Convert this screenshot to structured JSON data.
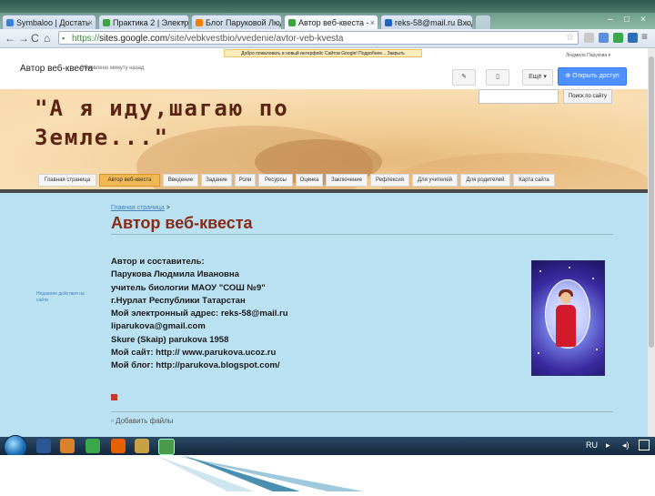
{
  "browser": {
    "tabs": [
      {
        "label": "Symbaloo | Достать"
      },
      {
        "label": "Практика 2 | Электр"
      },
      {
        "label": "Блог Паруковой Люд"
      },
      {
        "label": "Автор веб-квеста - "
      },
      {
        "label": "reks-58@mail.ru Вход"
      }
    ],
    "active_tab_index": 3,
    "url_scheme": "https://",
    "url_host": "sites.google.com",
    "url_path": "/site/vebkvestbio/vvedenie/avtor-veb-kvesta",
    "new_interface_banner": "Добро пожаловать в новый интерфейс Сайтов Google! Подробнее... Закрыть"
  },
  "site": {
    "header_title": "Автор веб-квеста",
    "updated_text": "Обновлено минуту назад",
    "user_name": "Людмила Парукова ▾",
    "edit_icon": "pencil-icon",
    "page_icon": "page-icon",
    "more_label": "Ещё ▾",
    "share_label": "Открыть доступ",
    "search_button_label": "Поиск по сайту",
    "search_placeholder": "",
    "banner_title": "\"А я иду,шагаю по\nЗемле...\"",
    "nav": [
      {
        "label": "Главная страница"
      },
      {
        "label": "Автор веб-квеста"
      },
      {
        "label": "Введение"
      },
      {
        "label": "Задание"
      },
      {
        "label": "Роли"
      },
      {
        "label": "Ресурсы"
      },
      {
        "label": "Оценка"
      },
      {
        "label": "Заключение"
      },
      {
        "label": "Рефлексия"
      },
      {
        "label": "Для учителей"
      },
      {
        "label": "Для родителей"
      },
      {
        "label": "Карта сайта"
      }
    ],
    "active_nav_index": 1,
    "breadcrumb_link": "Главная страница",
    "breadcrumb_sep": ">",
    "page_title": "Автор веб-квеста",
    "info_lines": [
      "Автор  и составитель:",
      "Парукова Людмила Ивановна",
      "учитель биологии  МАОУ \"СОШ №9\"",
      "г.Нурлат Республики Татарстан",
      "Мой электронный адрес: reks-58@mail.ru",
      "liparukova@gmail.com",
      "Skure (Skaip) parukova 1958",
      "Мой сайт: http:// www.parukova.ucoz.ru",
      "Мой блог: http://parukova.blogspot.com/"
    ],
    "sidebar_link": "Недавние действия на сайте",
    "add_files_label": "Добавить файлы"
  },
  "taskbar": {
    "lang": "RU"
  },
  "colors": {
    "content_bg": "#b9e1f1",
    "title_color": "#8a2a16",
    "active_nav": "#f0b755",
    "share_button": "#4d90fe"
  }
}
